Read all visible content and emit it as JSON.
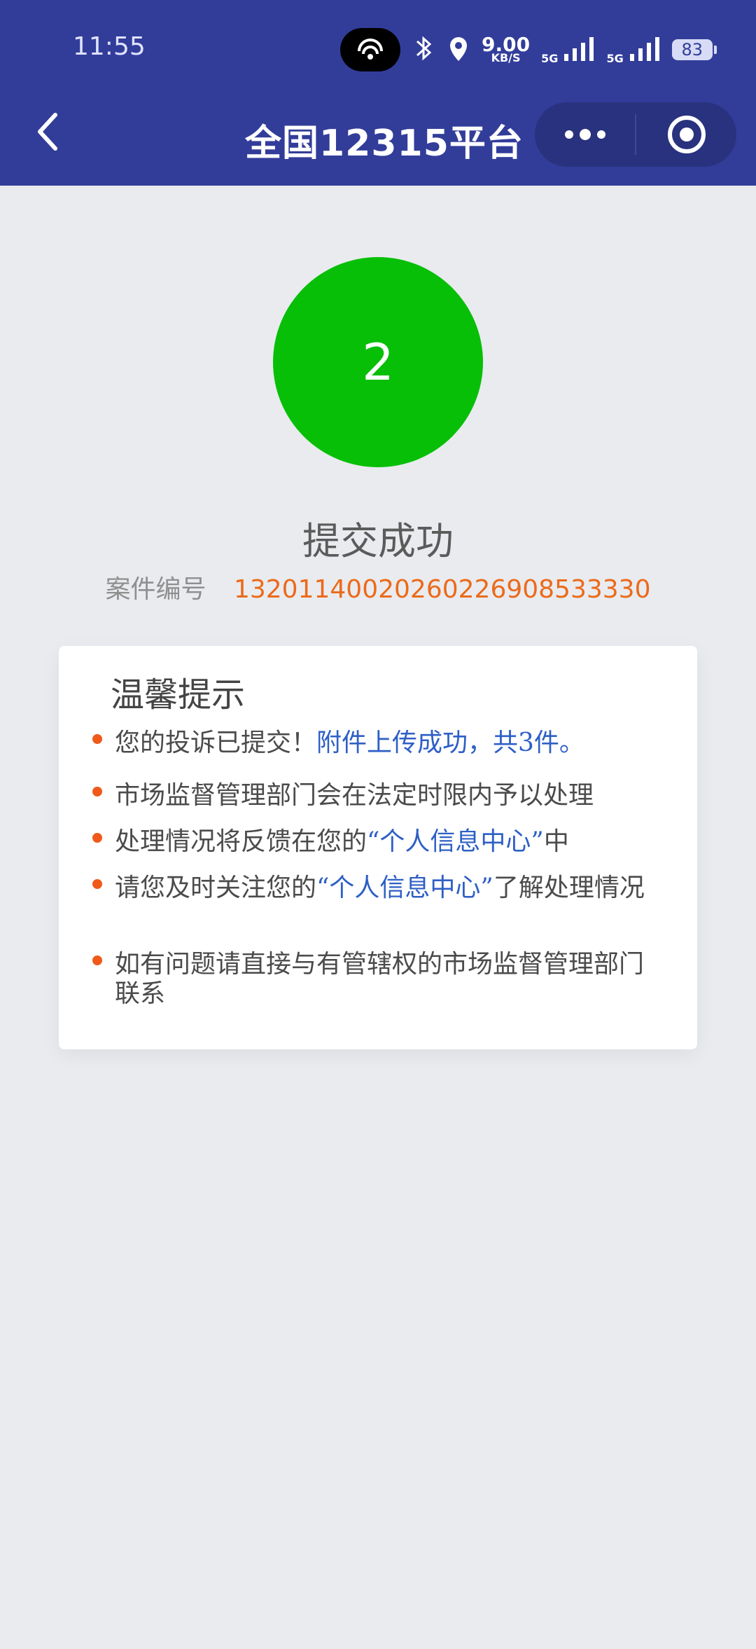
{
  "status_bar": {
    "time": "11:55",
    "net_speed": "9.00",
    "net_unit": "KB/S",
    "signal_1": "5G",
    "signal_2": "5G",
    "battery": "83"
  },
  "header": {
    "title": "全国12315平台"
  },
  "step": {
    "number": "2"
  },
  "result": {
    "title": "提交成功",
    "case_label": "案件编号",
    "case_number": "13201140020260226908533330"
  },
  "tips": {
    "title": "温馨提示",
    "items": [
      {
        "text": "您的投诉已提交！",
        "highlight": "附件上传成功，共3件。"
      },
      {
        "text": "市场监督管理部门会在法定时限内予以处理"
      },
      {
        "prefix": "处理情况将反馈在您的",
        "highlight": "“个人信息中心”",
        "suffix": "中"
      },
      {
        "prefix": "请您及时关注您的",
        "highlight": "“个人信息中心”",
        "suffix": "了解处理情况"
      },
      {
        "text": "如有问题请直接与有管辖权的市场监督管理部门联系"
      }
    ]
  },
  "colors": {
    "header_bg": "#323d9a",
    "success_green": "#07bf07",
    "accent_orange": "#ec6a1a",
    "link_blue": "#2e5fc6"
  }
}
